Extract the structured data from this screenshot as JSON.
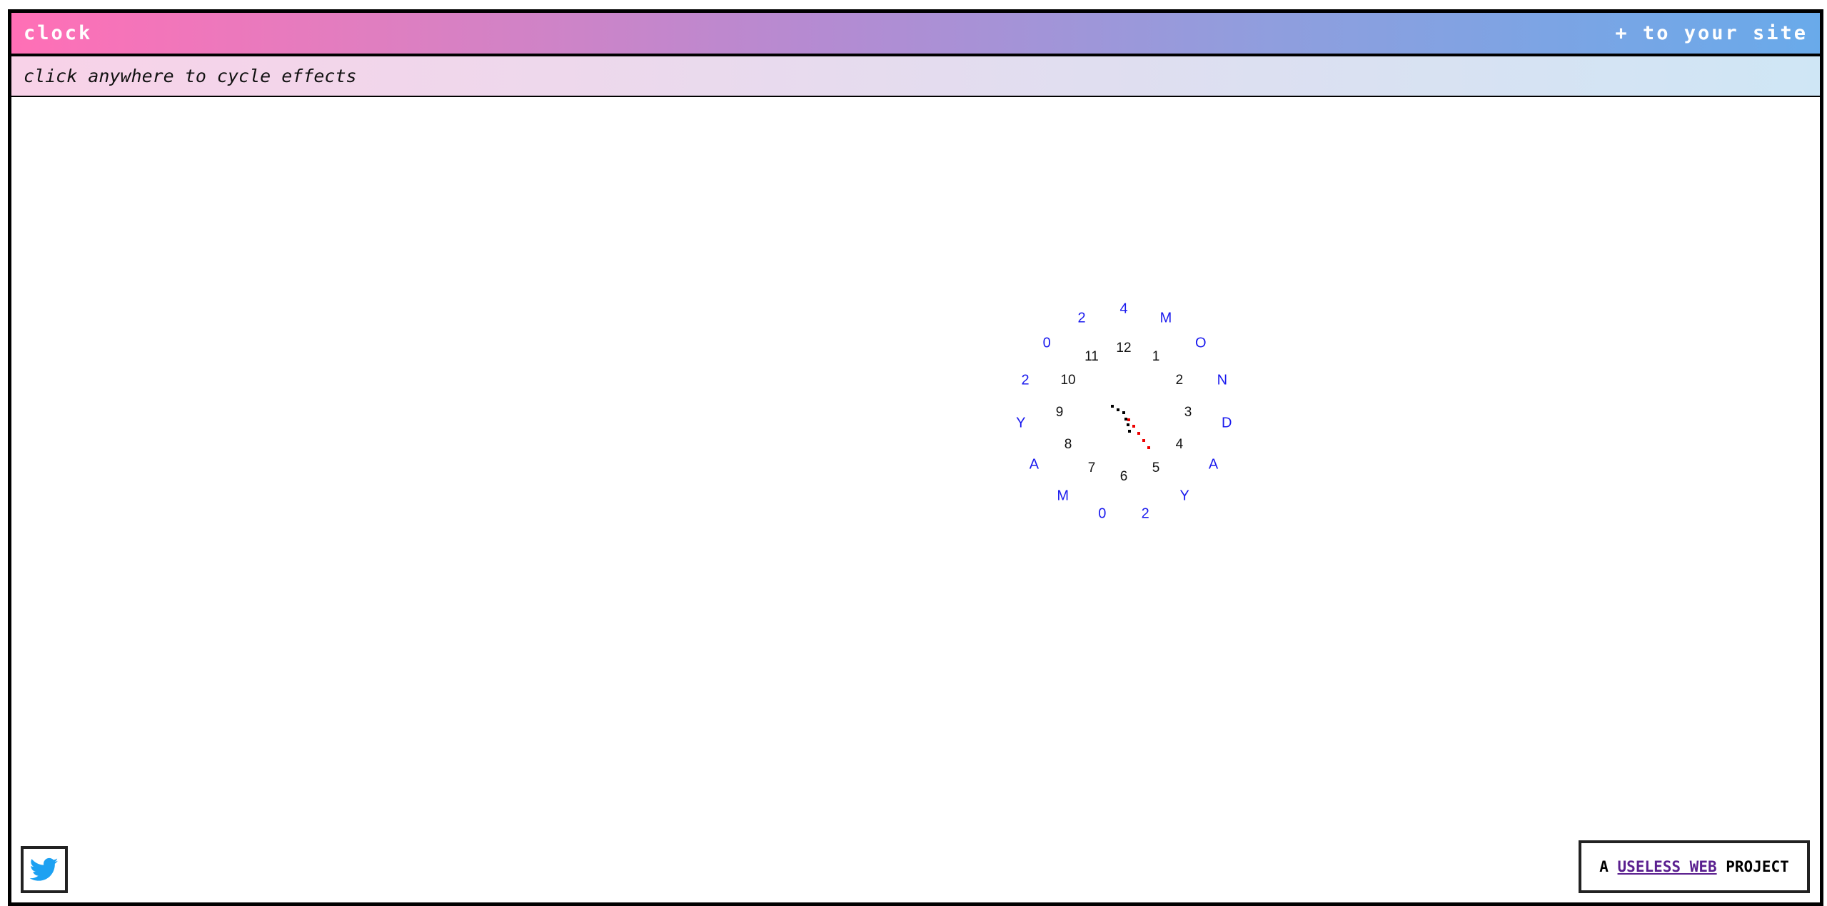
{
  "header": {
    "title": "clock",
    "add_link": "+ to your site"
  },
  "hint": {
    "text": "click anywhere to cycle effects"
  },
  "clock": {
    "hours": [
      "12",
      "1",
      "2",
      "3",
      "4",
      "5",
      "6",
      "7",
      "8",
      "9",
      "10",
      "11"
    ],
    "ring_text": [
      "M",
      "O",
      "N",
      "D",
      "A",
      "Y",
      "2",
      "0",
      "M",
      "A",
      "Y",
      "2",
      "0",
      "2",
      "4"
    ],
    "time": {
      "hour": 5,
      "minute": 24
    },
    "colors": {
      "numbers": "#111111",
      "ring": "#1a1aee",
      "hand_black": "#000000",
      "hand_red": "#ee0000"
    }
  },
  "footer": {
    "twitter_icon": "twitter-bird-icon",
    "badge_prefix": "A ",
    "badge_link": "USELESS WEB",
    "badge_suffix": " PROJECT"
  }
}
